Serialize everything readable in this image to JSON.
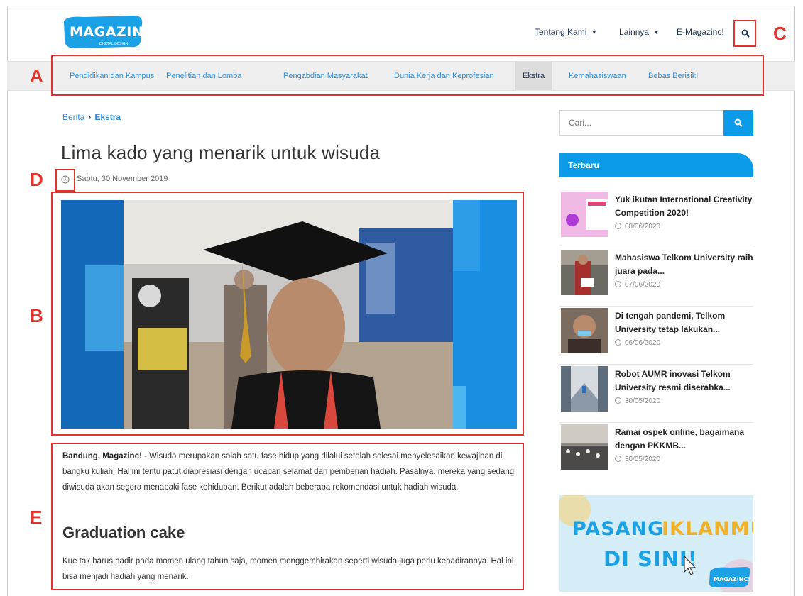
{
  "header": {
    "logo_text": "MAGAZINC!",
    "logo_tagline": "DIGITAL DESIGN",
    "nav": [
      {
        "label": "Tentang Kami",
        "has_dropdown": true
      },
      {
        "label": "Lainnya",
        "has_dropdown": true
      },
      {
        "label": "E-Magazinc!",
        "has_dropdown": false
      }
    ],
    "search_icon": "search-icon"
  },
  "categories": [
    "Pendidikan dan Kampus",
    "Penelitian dan Lomba",
    "Pengabdian Masyarakat",
    "Dunia Kerja dan Keprofesian",
    "Ekstra",
    "Kemahasiswaan",
    "Bebas Berisik!"
  ],
  "active_category": "Ekstra",
  "annotations": [
    "A",
    "B",
    "C",
    "D",
    "E"
  ],
  "article": {
    "breadcrumb": {
      "root": "Berita",
      "current": "Ekstra"
    },
    "title": "Lima kado yang menarik untuk wisuda",
    "date": "Sabtu, 30 November 2019",
    "intro_lead": "Bandung, Magazinc!",
    "intro_text": " - Wisuda merupakan salah satu fase hidup yang dilalui setelah selesai menyelesaikan kewajiban di bangku kuliah. Hal ini tentu patut diapresiasi dengan ucapan selamat dan pemberian hadiah. Pasalnya, mereka yang sedang diwisuda akan segera menapaki fase kehidupan. Berikut adalah beberapa rekomendasi untuk hadiah wisuda.",
    "subheading": "Graduation cake",
    "paragraph2": "Kue tak harus hadir pada momen ulang tahun saja, momen menggembirakan seperti wisuda juga perlu kehadirannya. Hal ini bisa menjadi hadiah yang menarik."
  },
  "sidebar": {
    "search_placeholder": "Cari...",
    "latest_heading": "Terbaru",
    "latest": [
      {
        "title": "Yuk ikutan International Creativity Competition 2020!",
        "date": "08/06/2020"
      },
      {
        "title": "Mahasiswa Telkom University raih juara pada...",
        "date": "07/06/2020"
      },
      {
        "title": "Di tengah pandemi, Telkom University tetap lakukan...",
        "date": "06/06/2020"
      },
      {
        "title": "Robot AUMR inovasi Telkom University resmi diserahka...",
        "date": "30/05/2020"
      },
      {
        "title": "Ramai ospek online, bagaimana dengan PKKMB...",
        "date": "30/05/2020"
      }
    ],
    "ad": {
      "line1a": "PASANG",
      "line1b": "IKLANMU",
      "line2": "DI SINI!",
      "badge": "MAGAZINC!"
    }
  },
  "colors": {
    "accent": "#0b9be8",
    "link": "#2f8ad8",
    "annotation": "#e0342c",
    "nav_text": "#1f3553"
  }
}
